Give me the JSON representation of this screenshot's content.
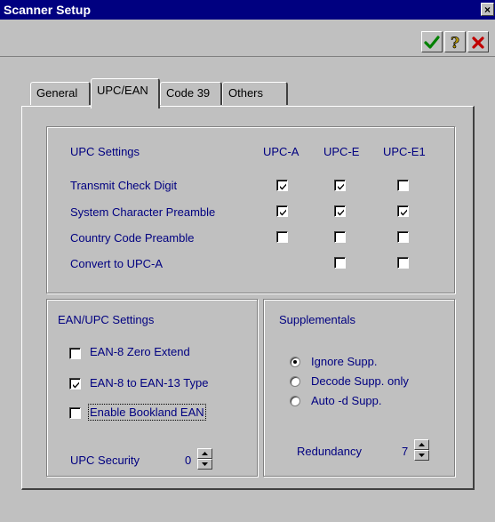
{
  "window": {
    "title": "Scanner Setup",
    "close_glyph": "×"
  },
  "toolbar": {
    "ok_icon": "checkmark-icon",
    "help_icon": "question-icon",
    "cancel_icon": "x-icon",
    "ok_color": "#008000",
    "cancel_color": "#c00000"
  },
  "tabs": [
    {
      "label": "General",
      "active": false
    },
    {
      "label": "UPC/EAN",
      "active": true
    },
    {
      "label": "Code 39",
      "active": false
    },
    {
      "label": "Others",
      "active": false
    }
  ],
  "upc_settings": {
    "title": "UPC Settings",
    "columns": [
      "UPC-A",
      "UPC-E",
      "UPC-E1"
    ],
    "rows": [
      {
        "label": "Transmit Check Digit",
        "values": [
          true,
          true,
          false
        ]
      },
      {
        "label": "System Character Preamble",
        "values": [
          true,
          true,
          true
        ]
      },
      {
        "label": "Country Code Preamble",
        "values": [
          false,
          false,
          false
        ]
      },
      {
        "label": "Convert to UPC-A",
        "values": [
          null,
          false,
          false
        ]
      }
    ]
  },
  "ean_settings": {
    "title": "EAN/UPC Settings",
    "options": [
      {
        "label": "EAN-8 Zero Extend",
        "checked": false
      },
      {
        "label": "EAN-8 to EAN-13 Type",
        "checked": true
      },
      {
        "label": "Enable Bookland EAN",
        "checked": false
      }
    ],
    "security_label": "UPC Security",
    "security_value": "0"
  },
  "supplementals": {
    "title": "Supplementals",
    "options": [
      {
        "label": "Ignore Supp.",
        "selected": true
      },
      {
        "label": "Decode Supp. only",
        "selected": false
      },
      {
        "label": "Auto -d Supp.",
        "selected": false
      }
    ],
    "redundancy_label": "Redundancy",
    "redundancy_value": "7"
  },
  "colors": {
    "label_blue": "#000080",
    "face": "#c0c0c0",
    "titlebar": "#000080"
  }
}
